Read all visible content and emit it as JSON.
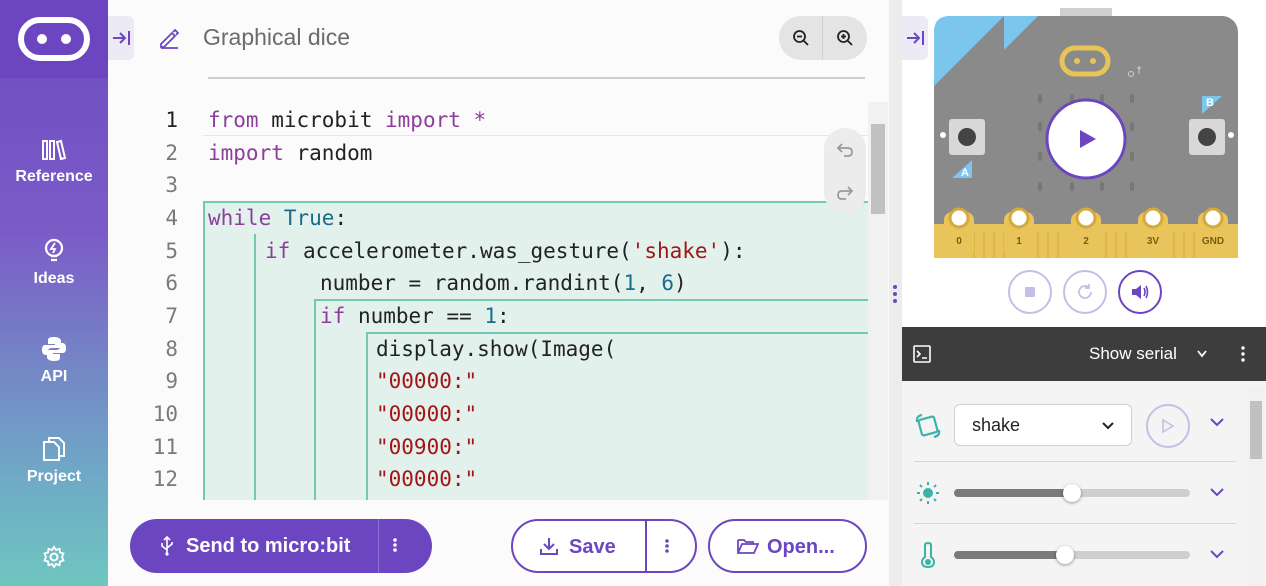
{
  "sidebar": {
    "items": [
      {
        "label": "Reference",
        "icon": "reference-icon"
      },
      {
        "label": "Ideas",
        "icon": "lightbulb-icon"
      },
      {
        "label": "API",
        "icon": "python-icon"
      },
      {
        "label": "Project",
        "icon": "files-icon"
      }
    ],
    "settings_icon": "gear-icon"
  },
  "editor": {
    "project_title": "Graphical dice",
    "line_numbers": [
      "1",
      "2",
      "3",
      "4",
      "5",
      "6",
      "7",
      "8",
      "9",
      "10",
      "11",
      "12"
    ],
    "lines": [
      [
        {
          "t": "from ",
          "c": "kw"
        },
        {
          "t": "microbit ",
          "c": ""
        },
        {
          "t": "import",
          "c": "kw"
        },
        {
          "t": " *",
          "c": "kw"
        }
      ],
      [
        {
          "t": "import ",
          "c": "kw"
        },
        {
          "t": "random",
          "c": ""
        }
      ],
      [],
      [
        {
          "t": "while ",
          "c": "kw"
        },
        {
          "t": "True",
          "c": "bi"
        },
        {
          "t": ":",
          "c": ""
        }
      ],
      [
        {
          "t": "if ",
          "c": "kw"
        },
        {
          "t": "accelerometer.was_gesture(",
          "c": ""
        },
        {
          "t": "'shake'",
          "c": "str"
        },
        {
          "t": "):",
          "c": ""
        }
      ],
      [
        {
          "t": "number = random.randint(",
          "c": ""
        },
        {
          "t": "1",
          "c": "num"
        },
        {
          "t": ", ",
          "c": ""
        },
        {
          "t": "6",
          "c": "num"
        },
        {
          "t": ")",
          "c": ""
        }
      ],
      [
        {
          "t": "if ",
          "c": "kw"
        },
        {
          "t": "number == ",
          "c": ""
        },
        {
          "t": "1",
          "c": "num"
        },
        {
          "t": ":",
          "c": ""
        }
      ],
      [
        {
          "t": "display.show(Image(",
          "c": ""
        }
      ],
      [
        {
          "t": "\"00000:\"",
          "c": "str"
        }
      ],
      [
        {
          "t": "\"00000:\"",
          "c": "str"
        }
      ],
      [
        {
          "t": "\"00900:\"",
          "c": "str"
        }
      ],
      [
        {
          "t": "\"00000:\"",
          "c": "str"
        }
      ]
    ]
  },
  "toolbar": {
    "send_label": "Send to micro:bit",
    "save_label": "Save",
    "open_label": "Open..."
  },
  "simulator": {
    "pin_labels": [
      "0",
      "1",
      "2",
      "3V",
      "GND"
    ],
    "button_a": "A",
    "button_b": "B"
  },
  "serial": {
    "label": "Show serial"
  },
  "sensors": {
    "gesture": "shake",
    "light_level": 0.5,
    "temperature_level": 0.47
  },
  "colors": {
    "brand": "#6c46c0",
    "block_bg": "#e2f1ec",
    "block_border": "#74c7b3"
  }
}
